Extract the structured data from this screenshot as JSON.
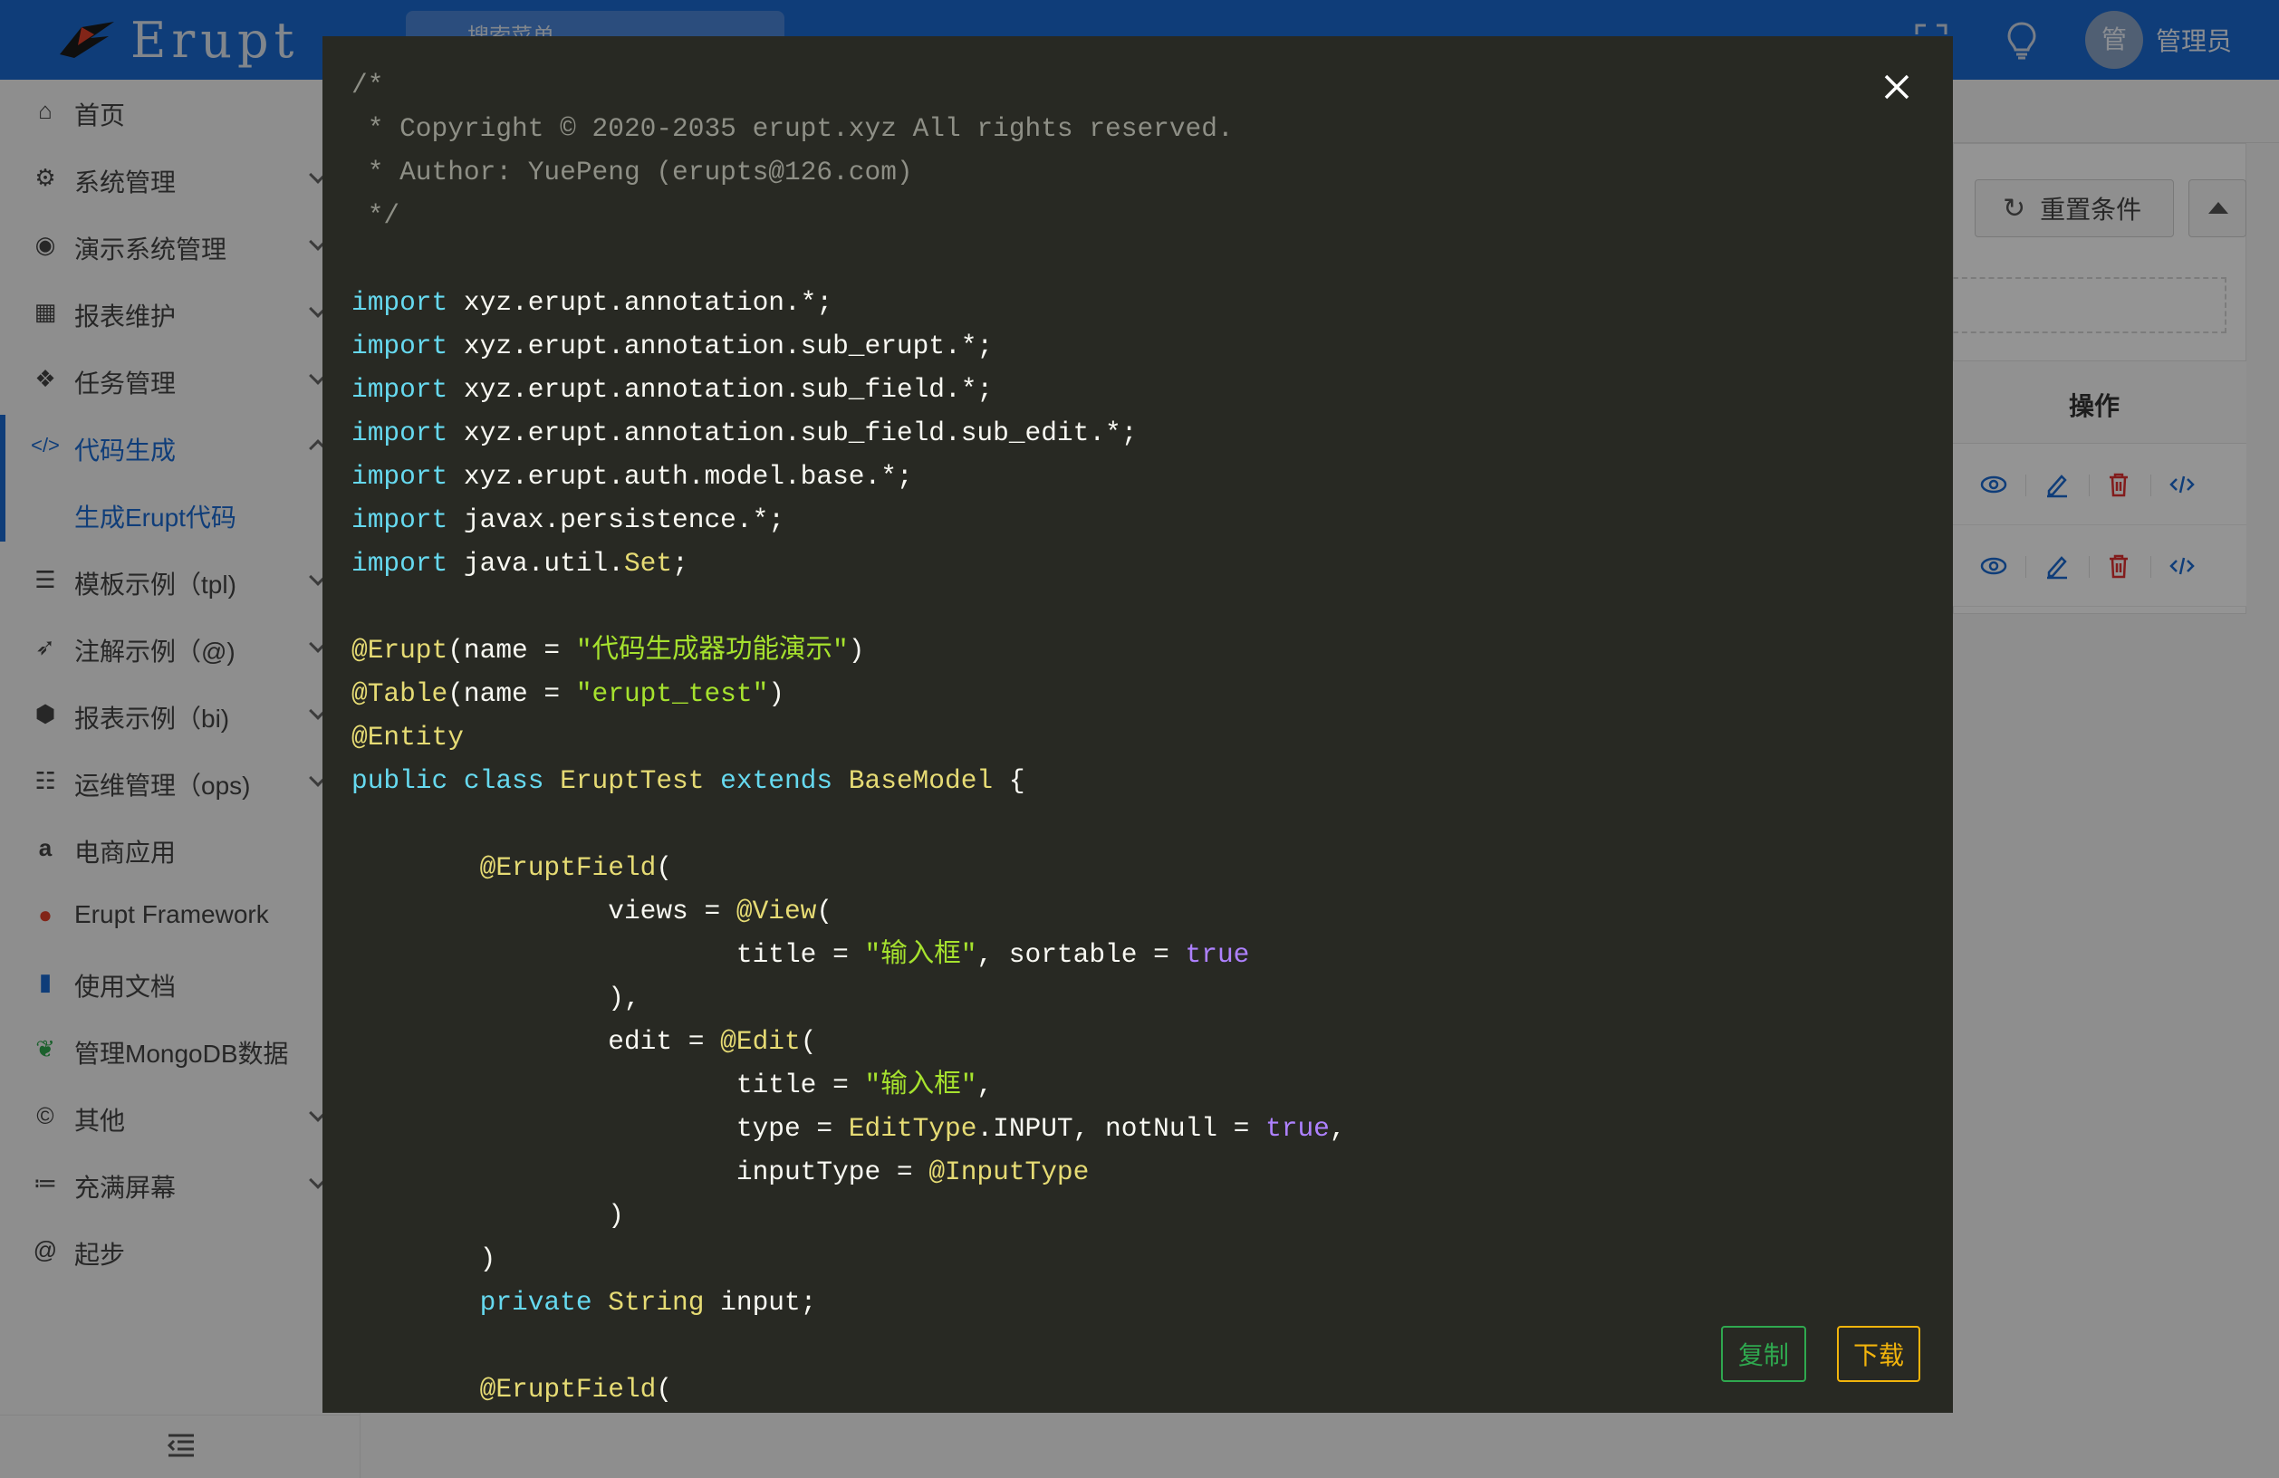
{
  "header": {
    "app_name": "Erupt",
    "search_placeholder": "搜索菜单",
    "user_avatar_text": "管",
    "username": "管理员"
  },
  "sidebar": {
    "items": [
      {
        "label": "首页",
        "icon": "home-icon"
      },
      {
        "label": "系统管理",
        "icon": "settings-icon"
      },
      {
        "label": "演示系统管理",
        "icon": "record-icon"
      },
      {
        "label": "报表维护",
        "icon": "table-icon"
      },
      {
        "label": "任务管理",
        "icon": "cubes-icon"
      },
      {
        "label": "代码生成",
        "icon": "code-icon"
      },
      {
        "label": "生成Erupt代码",
        "icon": ""
      },
      {
        "label": "模板示例（tpl)",
        "icon": "tpl-icon"
      },
      {
        "label": "注解示例（@)",
        "icon": "rocket-icon"
      },
      {
        "label": "报表示例（bi)",
        "icon": "box-icon"
      },
      {
        "label": "运维管理（ops)",
        "icon": "server-icon"
      },
      {
        "label": "电商应用",
        "icon": "amazon-icon"
      },
      {
        "label": "Erupt Framework",
        "icon": "fire-icon"
      },
      {
        "label": "使用文档",
        "icon": "book-icon"
      },
      {
        "label": "管理MongoDB数据",
        "icon": "leaf-icon"
      },
      {
        "label": "其他",
        "icon": "copyright-icon"
      },
      {
        "label": "充满屏幕",
        "icon": "list-icon"
      },
      {
        "label": "起步",
        "icon": "at-icon"
      }
    ]
  },
  "background": {
    "reset_label": "重置条件",
    "ops_header": "操作"
  },
  "modal": {
    "copy_label": "复制",
    "download_label": "下载",
    "code_lines": [
      [
        [
          "c",
          "/*"
        ]
      ],
      [
        [
          "c",
          " * Copyright © 2020-2035 erupt.xyz All rights reserved."
        ]
      ],
      [
        [
          "c",
          " * Author: YuePeng (erupts@126.com)"
        ]
      ],
      [
        [
          "c",
          " */"
        ]
      ],
      [],
      [
        [
          "k",
          "import"
        ],
        [
          "p",
          " xyz.erupt.annotation.*;"
        ]
      ],
      [
        [
          "k",
          "import"
        ],
        [
          "p",
          " xyz.erupt.annotation.sub_erupt.*;"
        ]
      ],
      [
        [
          "k",
          "import"
        ],
        [
          "p",
          " xyz.erupt.annotation.sub_field.*;"
        ]
      ],
      [
        [
          "k",
          "import"
        ],
        [
          "p",
          " xyz.erupt.annotation.sub_field.sub_edit.*;"
        ]
      ],
      [
        [
          "k",
          "import"
        ],
        [
          "p",
          " xyz.erupt.auth.model.base.*;"
        ]
      ],
      [
        [
          "k",
          "import"
        ],
        [
          "p",
          " javax.persistence.*;"
        ]
      ],
      [
        [
          "k",
          "import"
        ],
        [
          "p",
          " java.util."
        ],
        [
          "t",
          "Set"
        ],
        [
          "p",
          ";"
        ]
      ],
      [],
      [
        [
          "a",
          "@Erupt"
        ],
        [
          "p",
          "(name = "
        ],
        [
          "s",
          "\"代码生成器功能演示\""
        ],
        [
          "p",
          ")"
        ]
      ],
      [
        [
          "a",
          "@Table"
        ],
        [
          "p",
          "(name = "
        ],
        [
          "s",
          "\"erupt_test\""
        ],
        [
          "p",
          ")"
        ]
      ],
      [
        [
          "a",
          "@Entity"
        ]
      ],
      [
        [
          "k",
          "public"
        ],
        [
          "p",
          " "
        ],
        [
          "k",
          "class"
        ],
        [
          "p",
          " "
        ],
        [
          "t",
          "EruptTest"
        ],
        [
          "p",
          " "
        ],
        [
          "k",
          "extends"
        ],
        [
          "p",
          " "
        ],
        [
          "t",
          "BaseModel"
        ],
        [
          "p",
          " {"
        ]
      ],
      [],
      [
        [
          "p",
          "        "
        ],
        [
          "a",
          "@EruptField"
        ],
        [
          "p",
          "("
        ]
      ],
      [
        [
          "p",
          "                views = "
        ],
        [
          "a",
          "@View"
        ],
        [
          "p",
          "("
        ]
      ],
      [
        [
          "p",
          "                        title = "
        ],
        [
          "s",
          "\"输入框\""
        ],
        [
          "p",
          ", sortable = "
        ],
        [
          "n",
          "true"
        ]
      ],
      [
        [
          "p",
          "                ),"
        ]
      ],
      [
        [
          "p",
          "                edit = "
        ],
        [
          "a",
          "@Edit"
        ],
        [
          "p",
          "("
        ]
      ],
      [
        [
          "p",
          "                        title = "
        ],
        [
          "s",
          "\"输入框\""
        ],
        [
          "p",
          ","
        ]
      ],
      [
        [
          "p",
          "                        type = "
        ],
        [
          "t",
          "EditType"
        ],
        [
          "p",
          ".INPUT, notNull = "
        ],
        [
          "n",
          "true"
        ],
        [
          "p",
          ","
        ]
      ],
      [
        [
          "p",
          "                        inputType = "
        ],
        [
          "a",
          "@InputType"
        ]
      ],
      [
        [
          "p",
          "                )"
        ]
      ],
      [
        [
          "p",
          "        )"
        ]
      ],
      [
        [
          "p",
          "        "
        ],
        [
          "k",
          "private"
        ],
        [
          "p",
          " "
        ],
        [
          "t",
          "String"
        ],
        [
          "p",
          " input;"
        ]
      ],
      [],
      [
        [
          "p",
          "        "
        ],
        [
          "a",
          "@EruptField"
        ],
        [
          "p",
          "("
        ]
      ]
    ]
  },
  "colors": {
    "header_bg": "#1b6ad1",
    "modal_bg": "#282923",
    "copy_btn": "#2fa84f",
    "download_btn": "#f2b40c"
  }
}
